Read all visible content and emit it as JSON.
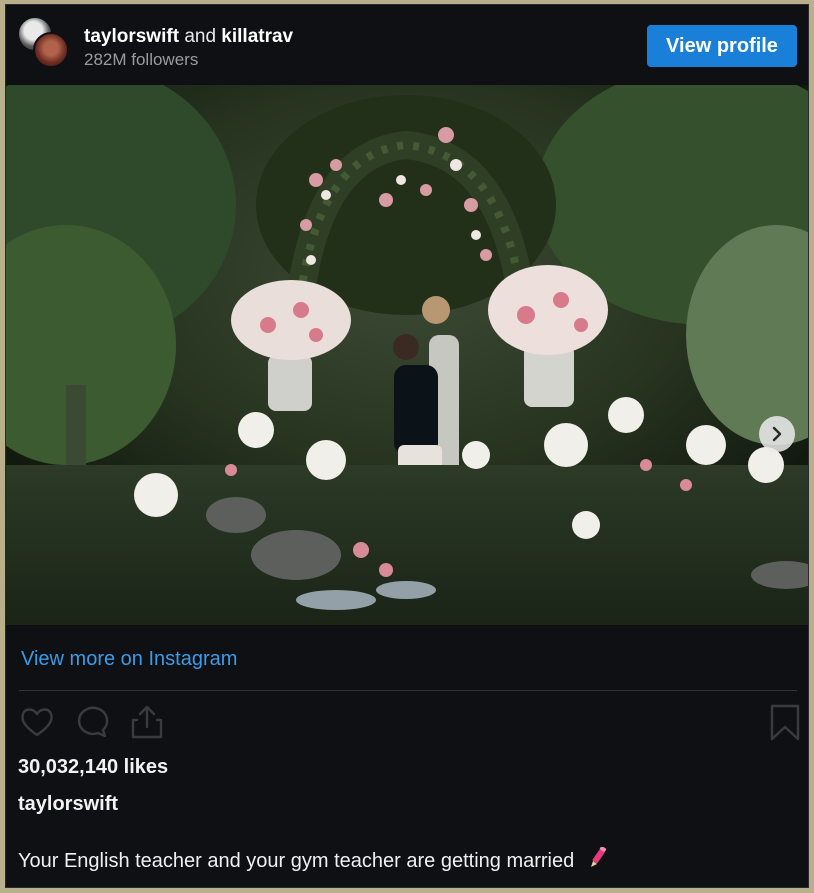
{
  "header": {
    "account_primary": "taylorswift",
    "connector": "and",
    "account_secondary": "killatrav",
    "followers": "282M followers",
    "view_profile_label": "View profile"
  },
  "post": {
    "view_more_label": "View more on Instagram",
    "likes": "30,032,140 likes",
    "username": "taylorswift",
    "caption": "Your English teacher and your gym teacher are getting married",
    "caption_emoji": "pencil-icon"
  },
  "icons": {
    "like": "heart-icon",
    "comment": "comment-icon",
    "share": "share-icon",
    "save": "bookmark-icon",
    "next": "chevron-right-icon"
  },
  "colors": {
    "accent": "#1a7fd9",
    "link": "#3a9be8",
    "background": "#0f1014",
    "frame": "#b7b08a"
  }
}
